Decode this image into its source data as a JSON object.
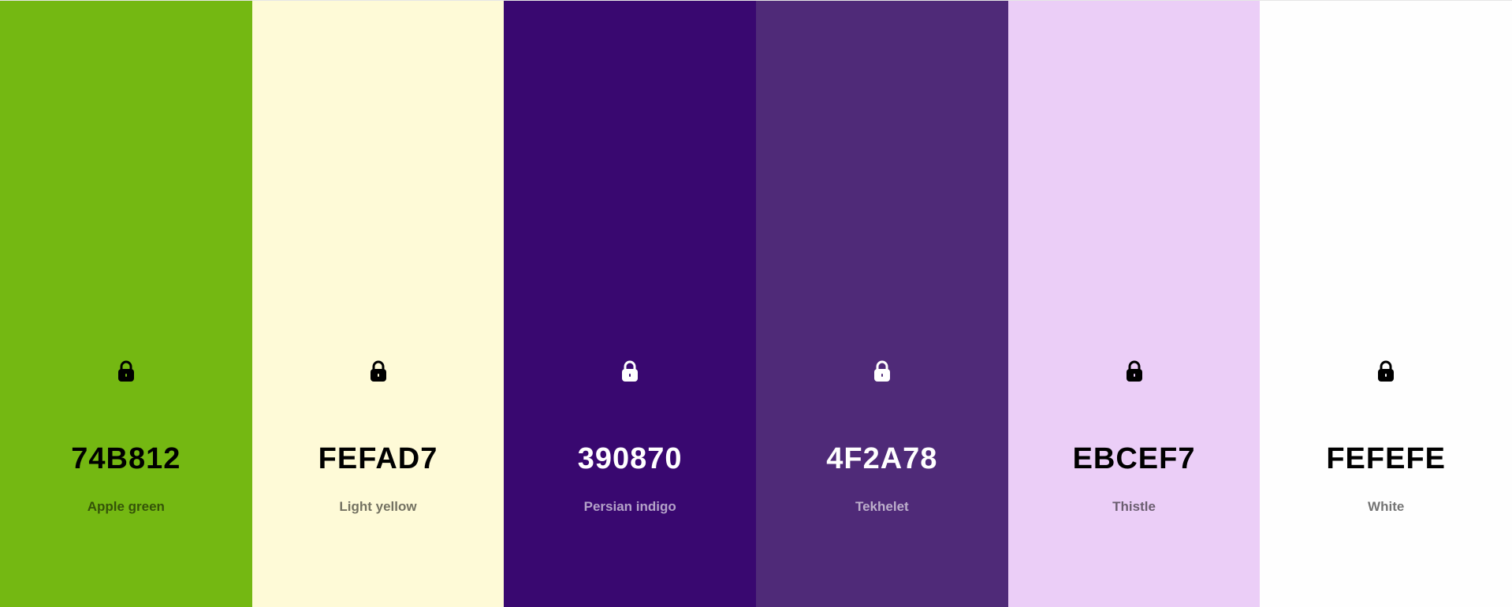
{
  "palette": {
    "swatches": [
      {
        "hex": "74B812",
        "name": "Apple green",
        "color": "#74B812",
        "text_tone": "dark",
        "lock_icon": "lock-icon"
      },
      {
        "hex": "FEFAD7",
        "name": "Light yellow",
        "color": "#FEFAD7",
        "text_tone": "dark",
        "lock_icon": "lock-icon"
      },
      {
        "hex": "390870",
        "name": "Persian indigo",
        "color": "#390870",
        "text_tone": "light",
        "lock_icon": "lock-icon"
      },
      {
        "hex": "4F2A78",
        "name": "Tekhelet",
        "color": "#4F2A78",
        "text_tone": "light",
        "lock_icon": "lock-icon"
      },
      {
        "hex": "EBCEF7",
        "name": "Thistle",
        "color": "#EBCEF7",
        "text_tone": "dark",
        "lock_icon": "lock-icon"
      },
      {
        "hex": "FEFEFE",
        "name": "White",
        "color": "#FEFEFE",
        "text_tone": "dark",
        "lock_icon": "lock-icon"
      }
    ]
  }
}
